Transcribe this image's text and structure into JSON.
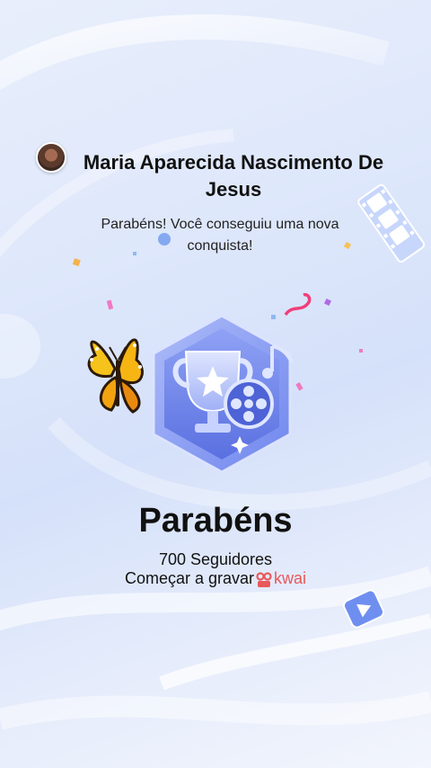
{
  "achievement": {
    "user_name": "Maria Aparecida Nascimento De Jesus",
    "message": "Parabéns! Você conseguiu uma nova conquista!",
    "headline": "Parabéns",
    "followers_text": "700 Seguidores",
    "record_text": "Começar a gravar",
    "brand_name": "kwai"
  },
  "icons": {
    "avatar": "user-avatar",
    "badge": "trophy-film-badge-icon",
    "butterfly": "butterfly-sticker",
    "brand_logo": "kwai-logo-icon",
    "play": "play-icon",
    "film": "film-strip-icon"
  },
  "colors": {
    "brand": "#e9585a",
    "badge_primary": "#6f86ee",
    "background": "#dfe8fb"
  }
}
